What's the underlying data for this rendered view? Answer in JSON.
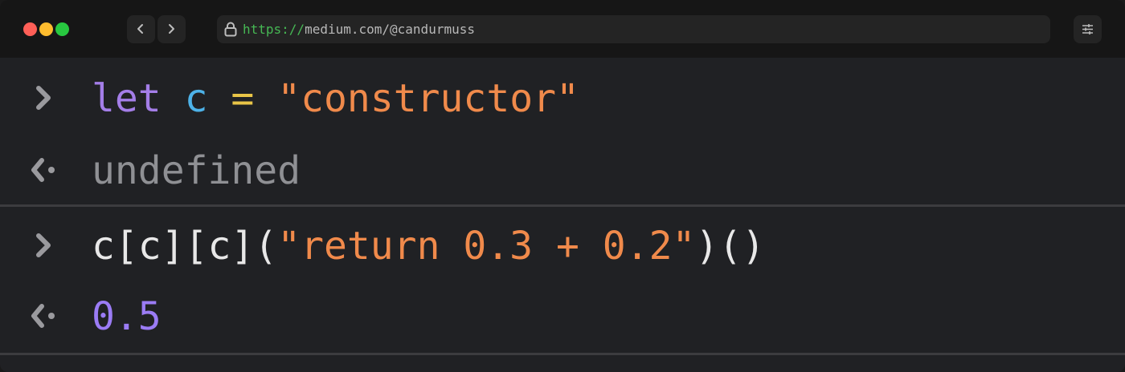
{
  "browser": {
    "url_scheme": "https://",
    "url_host": "medium.com/@candurmuss",
    "colors": {
      "close": "#ff5f57",
      "minimize": "#febc2e",
      "maximize": "#28c840",
      "scheme": "#46b854"
    }
  },
  "console": {
    "entries": [
      {
        "type": "input",
        "tokens": {
          "keyword": "let",
          "variable": "c",
          "operator": "=",
          "string": "\"constructor\""
        }
      },
      {
        "type": "output",
        "value": "undefined"
      },
      {
        "type": "input",
        "tokens": {
          "expr": "c[c][c](",
          "string": "\"return 0.3 + 0.2\"",
          "call": ")()"
        }
      },
      {
        "type": "output",
        "value": "0.5"
      }
    ],
    "icons": {
      "input": "chevron-right-icon",
      "output": "return-arrow-icon"
    },
    "colors": {
      "keyword": "#a47ee8",
      "variable": "#4db2e8",
      "operator": "#e9c547",
      "string": "#f08a4b",
      "result_number": "#9b7cf5",
      "muted": "#8f9094"
    }
  }
}
